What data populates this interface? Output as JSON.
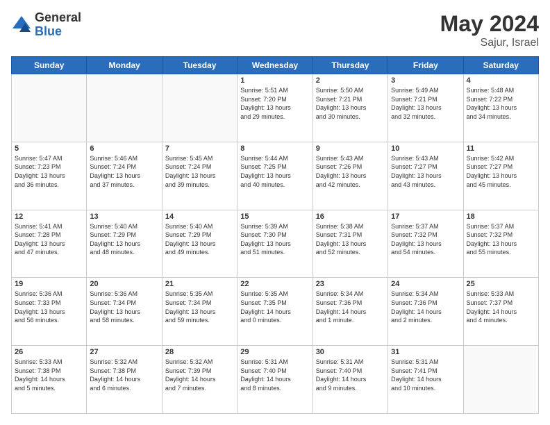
{
  "header": {
    "logo_general": "General",
    "logo_blue": "Blue",
    "month_year": "May 2024",
    "location": "Sajur, Israel"
  },
  "weekdays": [
    "Sunday",
    "Monday",
    "Tuesday",
    "Wednesday",
    "Thursday",
    "Friday",
    "Saturday"
  ],
  "weeks": [
    [
      {
        "day": "",
        "info": ""
      },
      {
        "day": "",
        "info": ""
      },
      {
        "day": "",
        "info": ""
      },
      {
        "day": "1",
        "info": "Sunrise: 5:51 AM\nSunset: 7:20 PM\nDaylight: 13 hours\nand 29 minutes."
      },
      {
        "day": "2",
        "info": "Sunrise: 5:50 AM\nSunset: 7:21 PM\nDaylight: 13 hours\nand 30 minutes."
      },
      {
        "day": "3",
        "info": "Sunrise: 5:49 AM\nSunset: 7:21 PM\nDaylight: 13 hours\nand 32 minutes."
      },
      {
        "day": "4",
        "info": "Sunrise: 5:48 AM\nSunset: 7:22 PM\nDaylight: 13 hours\nand 34 minutes."
      }
    ],
    [
      {
        "day": "5",
        "info": "Sunrise: 5:47 AM\nSunset: 7:23 PM\nDaylight: 13 hours\nand 36 minutes."
      },
      {
        "day": "6",
        "info": "Sunrise: 5:46 AM\nSunset: 7:24 PM\nDaylight: 13 hours\nand 37 minutes."
      },
      {
        "day": "7",
        "info": "Sunrise: 5:45 AM\nSunset: 7:24 PM\nDaylight: 13 hours\nand 39 minutes."
      },
      {
        "day": "8",
        "info": "Sunrise: 5:44 AM\nSunset: 7:25 PM\nDaylight: 13 hours\nand 40 minutes."
      },
      {
        "day": "9",
        "info": "Sunrise: 5:43 AM\nSunset: 7:26 PM\nDaylight: 13 hours\nand 42 minutes."
      },
      {
        "day": "10",
        "info": "Sunrise: 5:43 AM\nSunset: 7:27 PM\nDaylight: 13 hours\nand 43 minutes."
      },
      {
        "day": "11",
        "info": "Sunrise: 5:42 AM\nSunset: 7:27 PM\nDaylight: 13 hours\nand 45 minutes."
      }
    ],
    [
      {
        "day": "12",
        "info": "Sunrise: 5:41 AM\nSunset: 7:28 PM\nDaylight: 13 hours\nand 47 minutes."
      },
      {
        "day": "13",
        "info": "Sunrise: 5:40 AM\nSunset: 7:29 PM\nDaylight: 13 hours\nand 48 minutes."
      },
      {
        "day": "14",
        "info": "Sunrise: 5:40 AM\nSunset: 7:29 PM\nDaylight: 13 hours\nand 49 minutes."
      },
      {
        "day": "15",
        "info": "Sunrise: 5:39 AM\nSunset: 7:30 PM\nDaylight: 13 hours\nand 51 minutes."
      },
      {
        "day": "16",
        "info": "Sunrise: 5:38 AM\nSunset: 7:31 PM\nDaylight: 13 hours\nand 52 minutes."
      },
      {
        "day": "17",
        "info": "Sunrise: 5:37 AM\nSunset: 7:32 PM\nDaylight: 13 hours\nand 54 minutes."
      },
      {
        "day": "18",
        "info": "Sunrise: 5:37 AM\nSunset: 7:32 PM\nDaylight: 13 hours\nand 55 minutes."
      }
    ],
    [
      {
        "day": "19",
        "info": "Sunrise: 5:36 AM\nSunset: 7:33 PM\nDaylight: 13 hours\nand 56 minutes."
      },
      {
        "day": "20",
        "info": "Sunrise: 5:36 AM\nSunset: 7:34 PM\nDaylight: 13 hours\nand 58 minutes."
      },
      {
        "day": "21",
        "info": "Sunrise: 5:35 AM\nSunset: 7:34 PM\nDaylight: 13 hours\nand 59 minutes."
      },
      {
        "day": "22",
        "info": "Sunrise: 5:35 AM\nSunset: 7:35 PM\nDaylight: 14 hours\nand 0 minutes."
      },
      {
        "day": "23",
        "info": "Sunrise: 5:34 AM\nSunset: 7:36 PM\nDaylight: 14 hours\nand 1 minute."
      },
      {
        "day": "24",
        "info": "Sunrise: 5:34 AM\nSunset: 7:36 PM\nDaylight: 14 hours\nand 2 minutes."
      },
      {
        "day": "25",
        "info": "Sunrise: 5:33 AM\nSunset: 7:37 PM\nDaylight: 14 hours\nand 4 minutes."
      }
    ],
    [
      {
        "day": "26",
        "info": "Sunrise: 5:33 AM\nSunset: 7:38 PM\nDaylight: 14 hours\nand 5 minutes."
      },
      {
        "day": "27",
        "info": "Sunrise: 5:32 AM\nSunset: 7:38 PM\nDaylight: 14 hours\nand 6 minutes."
      },
      {
        "day": "28",
        "info": "Sunrise: 5:32 AM\nSunset: 7:39 PM\nDaylight: 14 hours\nand 7 minutes."
      },
      {
        "day": "29",
        "info": "Sunrise: 5:31 AM\nSunset: 7:40 PM\nDaylight: 14 hours\nand 8 minutes."
      },
      {
        "day": "30",
        "info": "Sunrise: 5:31 AM\nSunset: 7:40 PM\nDaylight: 14 hours\nand 9 minutes."
      },
      {
        "day": "31",
        "info": "Sunrise: 5:31 AM\nSunset: 7:41 PM\nDaylight: 14 hours\nand 10 minutes."
      },
      {
        "day": "",
        "info": ""
      }
    ]
  ]
}
